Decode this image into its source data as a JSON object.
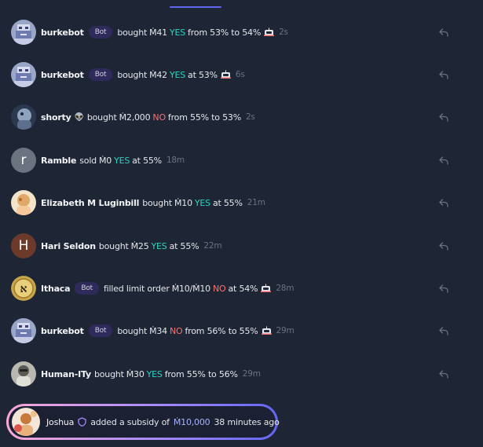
{
  "feed": [
    {
      "user": "burkebot",
      "bot_badge": "Bot",
      "action": "bought",
      "amount": "Ṁ41",
      "outcome": "YES",
      "outcome_type": "yes",
      "prob_text": "from 53% to 54%",
      "has_robot": true,
      "time": "2s",
      "avatar": "pixel"
    },
    {
      "user": "burkebot",
      "bot_badge": "Bot",
      "action": "bought",
      "amount": "Ṁ42",
      "outcome": "YES",
      "outcome_type": "yes",
      "prob_text": "at 53%",
      "has_robot": true,
      "time": "6s",
      "avatar": "pixel"
    },
    {
      "user": "shorty",
      "user_emoji": "👽",
      "action": "bought",
      "amount": "Ṁ2,000",
      "outcome": "NO",
      "outcome_type": "no",
      "prob_text": "from 55% to 53%",
      "has_robot": false,
      "time": "2s",
      "avatar": "photo-dark"
    },
    {
      "user": "Ramble",
      "action": "sold",
      "amount": "Ṁ0",
      "outcome": "YES",
      "outcome_type": "yes",
      "prob_text": "at 55%",
      "has_robot": false,
      "time": "18m",
      "avatar": "letter",
      "avatar_letter": "r",
      "avatar_color": "#6b7280"
    },
    {
      "user": "Elizabeth M Luginbill",
      "action": "bought",
      "amount": "Ṁ10",
      "outcome": "YES",
      "outcome_type": "yes",
      "prob_text": "at 55%",
      "has_robot": false,
      "time": "21m",
      "avatar": "photo-light"
    },
    {
      "user": "Hari Seldon",
      "action": "bought",
      "amount": "Ṁ25",
      "outcome": "YES",
      "outcome_type": "yes",
      "prob_text": "at 55%",
      "has_robot": false,
      "time": "22m",
      "avatar": "letter",
      "avatar_letter": "H",
      "avatar_color": "#6b3a2a"
    },
    {
      "user": "Ithaca",
      "bot_badge": "Bot",
      "action": "filled limit order",
      "amount": "Ṁ10/Ṁ10",
      "outcome": "NO",
      "outcome_type": "no",
      "prob_text": "at 54%",
      "has_robot": true,
      "time": "28m",
      "avatar": "coin"
    },
    {
      "user": "burkebot",
      "bot_badge": "Bot",
      "action": "bought",
      "amount": "Ṁ34",
      "outcome": "NO",
      "outcome_type": "no",
      "prob_text": "from 56% to 55%",
      "has_robot": true,
      "time": "29m",
      "avatar": "pixel"
    },
    {
      "user": "Human-ITy",
      "action": "bought",
      "amount": "Ṁ30",
      "outcome": "YES",
      "outcome_type": "yes",
      "prob_text": "from 55% to 56%",
      "has_robot": false,
      "time": "29m",
      "avatar": "photo-gray"
    }
  ],
  "subsidy": {
    "user": "Joshua",
    "text": "added a subsidy of",
    "amount": "Ṁ10,000",
    "time": "38 minutes ago"
  },
  "colors": {
    "yes": "#2dd4bf",
    "no": "#f87171",
    "accent": "#6366f1",
    "background": "#1e2636"
  },
  "icons": {
    "reply": "reply-arrow-icon",
    "robot": "robot-icon",
    "shield": "shield-icon"
  }
}
